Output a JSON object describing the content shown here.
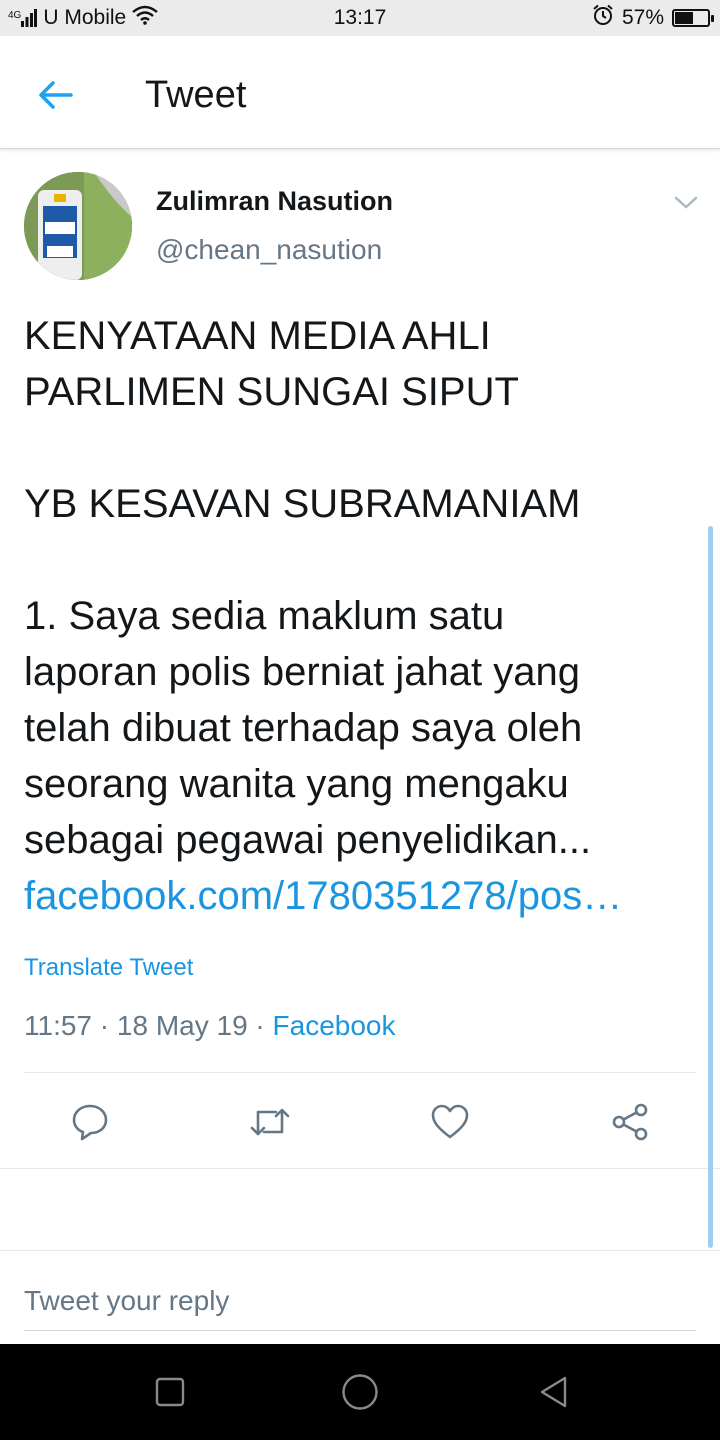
{
  "status_bar": {
    "network_type": "4G",
    "carrier": "U Mobile",
    "time": "13:17",
    "battery_percent_label": "57%",
    "battery_level": 0.57
  },
  "header": {
    "title": "Tweet"
  },
  "tweet": {
    "author_name": "Zulimran Nasution",
    "author_handle": "@chean_nasution",
    "lines": [
      "KENYATAAN MEDIA AHLI",
      "PARLIMEN SUNGAI SIPUT",
      "YB KESAVAN SUBRAMANIAM",
      "1. Saya sedia maklum satu",
      "laporan polis berniat jahat yang",
      "telah dibuat terhadap saya oleh",
      "seorang wanita yang mengaku",
      "sebagai pegawai penyelidikan..."
    ],
    "link": "facebook.com/1780351278/pos…",
    "translate_label": "Translate Tweet",
    "time": "11:57",
    "date": "18 May 19",
    "source": "Facebook",
    "separator": " · "
  },
  "reply": {
    "placeholder": "Tweet your reply"
  },
  "colors": {
    "accent": "#1b95e0",
    "secondary_text": "#657786",
    "primary_text": "#14171a"
  },
  "icons": [
    "back-arrow-icon",
    "wifi-icon",
    "signal-icon",
    "alarm-icon",
    "battery-icon",
    "chevron-down-icon",
    "reply-icon",
    "retweet-icon",
    "like-icon",
    "share-icon",
    "recents-icon",
    "home-icon",
    "back-triangle-icon"
  ]
}
